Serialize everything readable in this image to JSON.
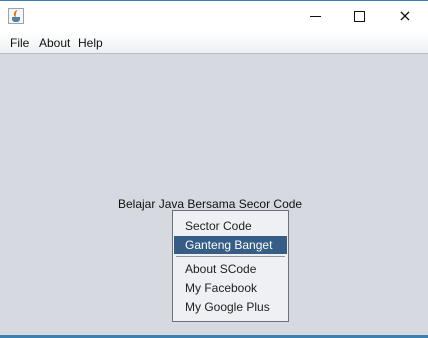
{
  "window": {
    "title": "",
    "icon": "java-cup-icon",
    "controls": {
      "minimize": "minimize-icon",
      "maximize": "maximize-icon",
      "close": "×"
    }
  },
  "menubar": {
    "items": [
      {
        "label": "File"
      },
      {
        "label": "About"
      },
      {
        "label": "Help"
      }
    ]
  },
  "main": {
    "label": "Belajar Java Bersama Secor Code"
  },
  "popup_menu": {
    "items": [
      {
        "label": "Sector Code",
        "selected": false
      },
      {
        "label": "Ganteng Banget",
        "selected": true
      },
      {
        "label": "About SCode",
        "selected": false
      },
      {
        "label": "My Facebook",
        "selected": false
      },
      {
        "label": "My Google Plus",
        "selected": false
      }
    ]
  },
  "colors": {
    "background": "#d6d9df",
    "selection": "#355d85",
    "accent_border": "#3c7fb1"
  }
}
